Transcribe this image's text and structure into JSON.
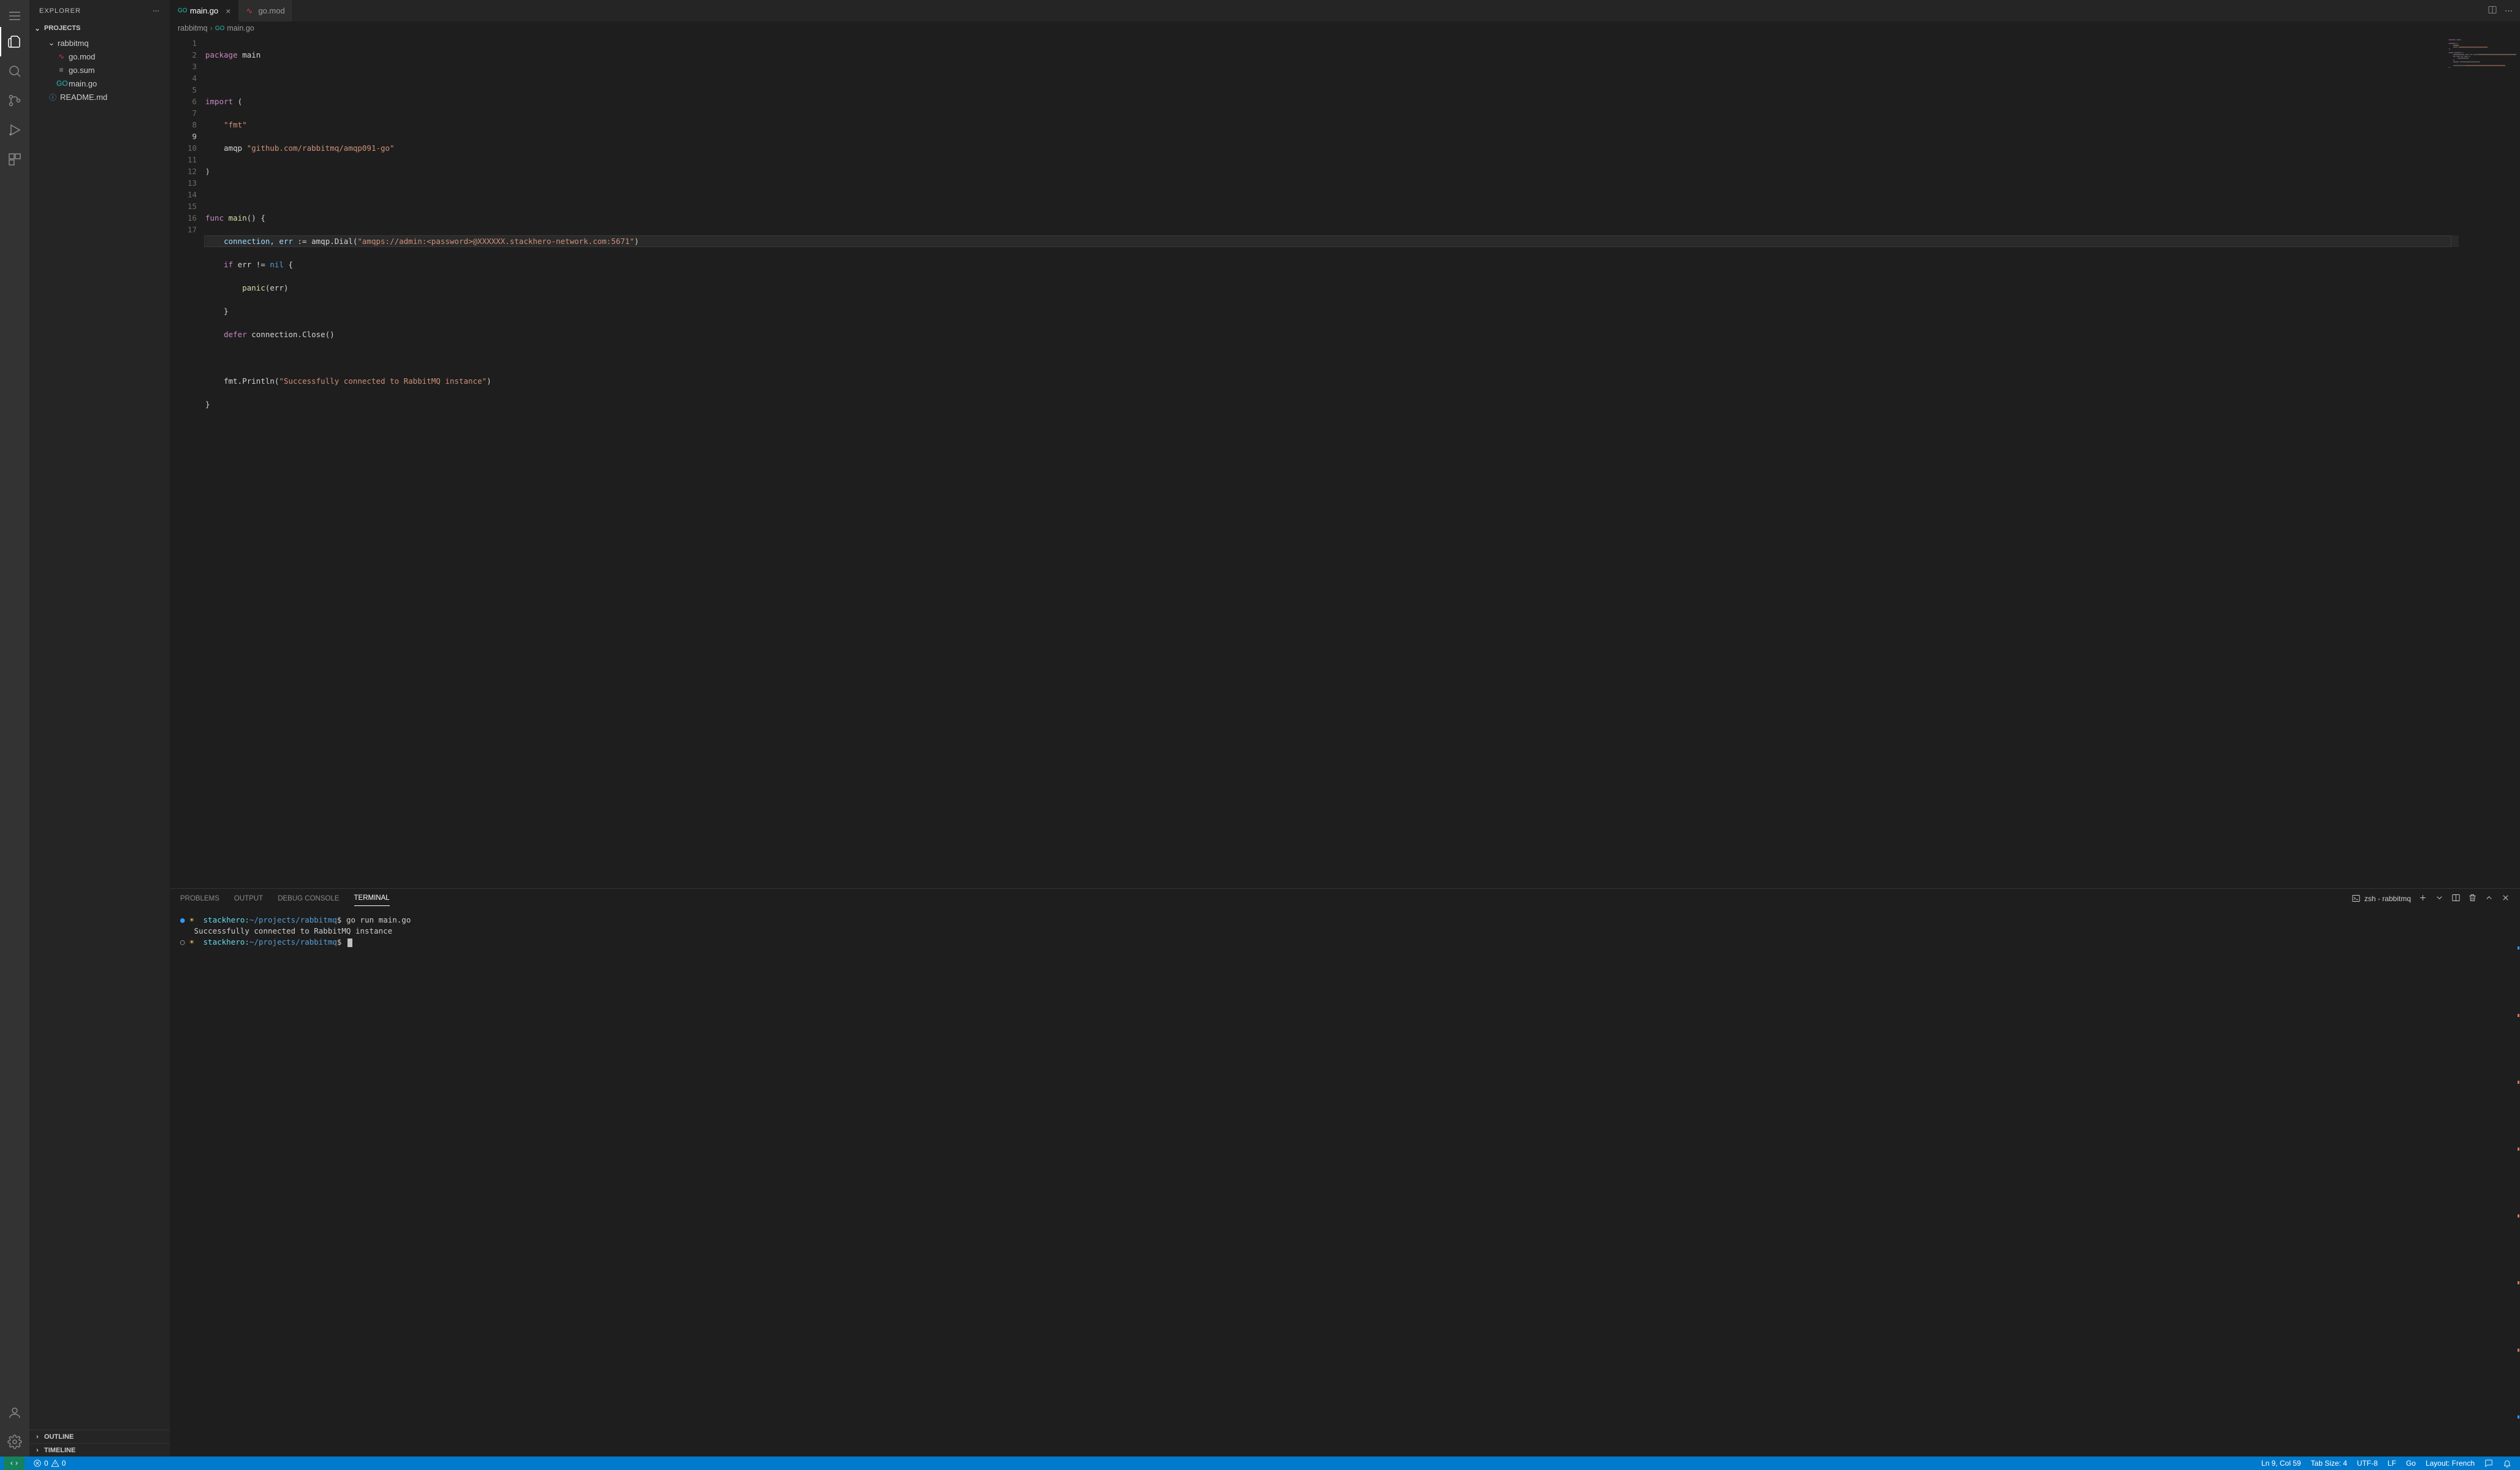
{
  "sidebar": {
    "title": "EXPLORER",
    "section_projects": "PROJECTS",
    "folder": "rabbitmq",
    "files": [
      "go.mod",
      "go.sum",
      "main.go",
      "README.md"
    ],
    "section_outline": "OUTLINE",
    "section_timeline": "TIMELINE"
  },
  "tabs": [
    {
      "label": "main.go",
      "active": true,
      "icon": "go"
    },
    {
      "label": "go.mod",
      "active": false,
      "icon": "mod"
    }
  ],
  "breadcrumbs": {
    "folder": "rabbitmq",
    "file": "main.go"
  },
  "editor": {
    "line_count": 17,
    "current_line": 9
  },
  "code": {
    "l1_kw": "package",
    "l1_id": "main",
    "l3_kw": "import",
    "l3_p": "(",
    "l4_str": "\"fmt\"",
    "l5_id": "amqp",
    "l5_str": "\"github.com/rabbitmq/amqp091-go\"",
    "l6_p": ")",
    "l8_kw": "func",
    "l8_fn": "main",
    "l8_sig": "() {",
    "l9_vars": "connection, err",
    "l9_op": ":=",
    "l9_call": "amqp.Dial",
    "l9_str": "\"amqps://admin:<password>@XXXXXX.stackhero-network.com:5671\"",
    "l10_kw": "if",
    "l10_cond": "err != ",
    "l10_nil": "nil",
    "l10_brace": " {",
    "l11_fn": "panic",
    "l11_arg": "err",
    "l12_p": "}",
    "l13_kw": "defer",
    "l13_call": "connection.Close()",
    "l15_call": "fmt.Println",
    "l15_str": "\"Successfully connected to RabbitMQ instance\"",
    "l16_p": "}"
  },
  "panel": {
    "problems": "PROBLEMS",
    "output": "OUTPUT",
    "debug": "DEBUG CONSOLE",
    "terminal": "TERMINAL",
    "term_name": "zsh - rabbitmq"
  },
  "terminal": {
    "user": "stackhero",
    "path": "~/projects/rabbitmq",
    "cmd1": "go run main.go",
    "out1": "Successfully connected to RabbitMQ instance"
  },
  "status": {
    "errors": "0",
    "warnings": "0",
    "cursor": "Ln 9, Col 59",
    "tab": "Tab Size: 4",
    "encoding": "UTF-8",
    "eol": "LF",
    "lang": "Go",
    "layout": "Layout: French"
  }
}
